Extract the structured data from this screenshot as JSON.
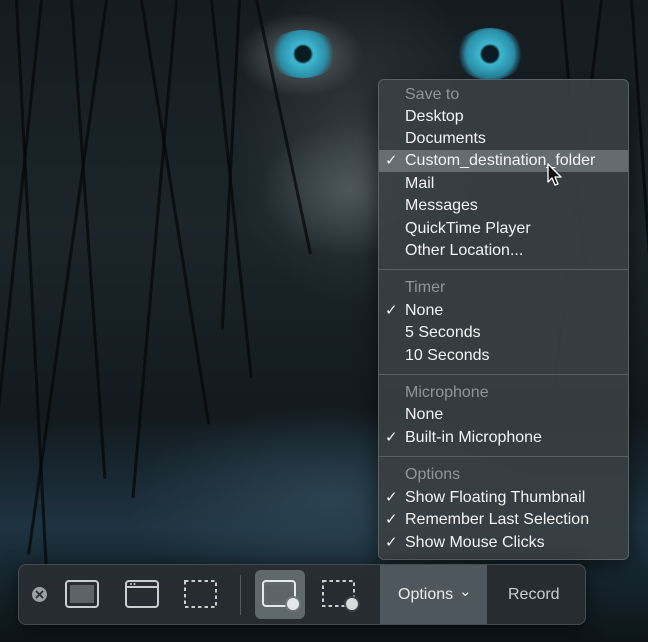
{
  "menu": {
    "save_to": {
      "header": "Save to",
      "items": [
        {
          "label": "Desktop",
          "checked": false,
          "highlighted": false
        },
        {
          "label": "Documents",
          "checked": false,
          "highlighted": false
        },
        {
          "label": "Custom_destination_folder",
          "checked": true,
          "highlighted": true
        },
        {
          "label": "Mail",
          "checked": false,
          "highlighted": false
        },
        {
          "label": "Messages",
          "checked": false,
          "highlighted": false
        },
        {
          "label": "QuickTime Player",
          "checked": false,
          "highlighted": false
        },
        {
          "label": "Other Location...",
          "checked": false,
          "highlighted": false
        }
      ]
    },
    "timer": {
      "header": "Timer",
      "items": [
        {
          "label": "None",
          "checked": true
        },
        {
          "label": "5 Seconds",
          "checked": false
        },
        {
          "label": "10 Seconds",
          "checked": false
        }
      ]
    },
    "microphone": {
      "header": "Microphone",
      "items": [
        {
          "label": "None",
          "checked": false
        },
        {
          "label": "Built-in Microphone",
          "checked": true
        }
      ]
    },
    "options": {
      "header": "Options",
      "items": [
        {
          "label": "Show Floating Thumbnail",
          "checked": true
        },
        {
          "label": "Remember Last Selection",
          "checked": true
        },
        {
          "label": "Show Mouse Clicks",
          "checked": true
        }
      ]
    },
    "check_glyph": "✓"
  },
  "toolbar": {
    "close_icon": "close-icon",
    "options_label": "Options",
    "options_chevron": "⌄",
    "record_label": "Record"
  },
  "colors": {
    "menu_bg": "#3a4044",
    "highlight": "#8c9498",
    "header_text": "#8e969a",
    "toolbar_bg": "#282e32"
  }
}
